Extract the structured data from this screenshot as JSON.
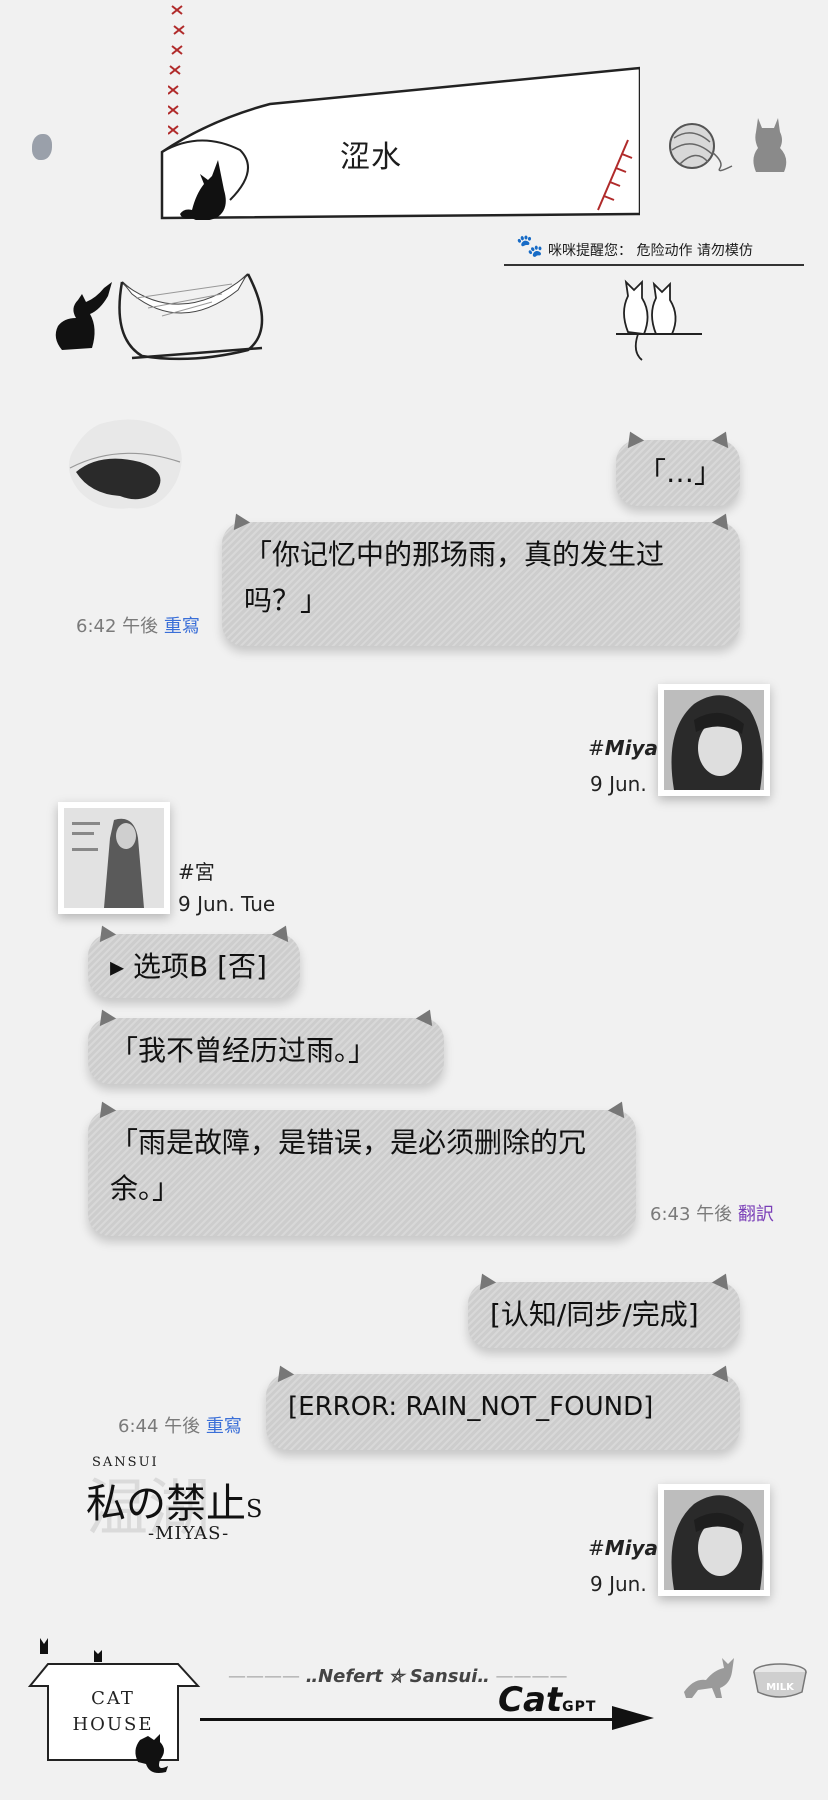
{
  "header": {
    "title": "涩水",
    "warning": "咪咪提醒您：  危险动作  请勿模仿"
  },
  "messages": [
    {
      "side": "right",
      "text": "「…」"
    },
    {
      "side": "right",
      "text": "「你记忆中的那场雨，真的发生过吗？」",
      "time": "6:42 午後",
      "action": "重寫"
    },
    {
      "side": "left",
      "text": "▸ 选项B [否]"
    },
    {
      "side": "left",
      "text": "「我不曾经历过雨。」"
    },
    {
      "side": "left",
      "text": "「雨是故障，是错误，是必须删除的冗余。」",
      "time": "6:43 午後",
      "action": "翻訳"
    },
    {
      "side": "right",
      "text": "[认知/同步/完成]"
    },
    {
      "side": "right",
      "text": "[ERROR: RAIN_NOT_FOUND]",
      "time": "6:44 午後",
      "action": "重寫"
    }
  ],
  "profiles": {
    "miya": {
      "name_hash": "#",
      "name": "Miya",
      "date": "9 Jun."
    },
    "miya2": {
      "name_hash": "#",
      "name": "Miya",
      "date": "9 Jun."
    },
    "gong": {
      "name": "#宮",
      "date": "9 Jun. Tue"
    }
  },
  "brand": {
    "sansui": "SANSUI",
    "title": "私の禁止",
    "title_s": "S",
    "miyas": "-MIYAS-",
    "bg_mark": "温湖"
  },
  "footer": {
    "house_line1": "CAT",
    "house_line2": "HOUSE",
    "nefert": "‥Nefert ⛤ Sansui‥",
    "cat": "Cat",
    "gpt": "GPT",
    "milk": "MILK"
  },
  "colors": {
    "bubble": "#cdcdcd",
    "rewrite_link": "#3a6fd8",
    "translate_link": "#7a3fb8",
    "stitch": "#b02a2a"
  }
}
